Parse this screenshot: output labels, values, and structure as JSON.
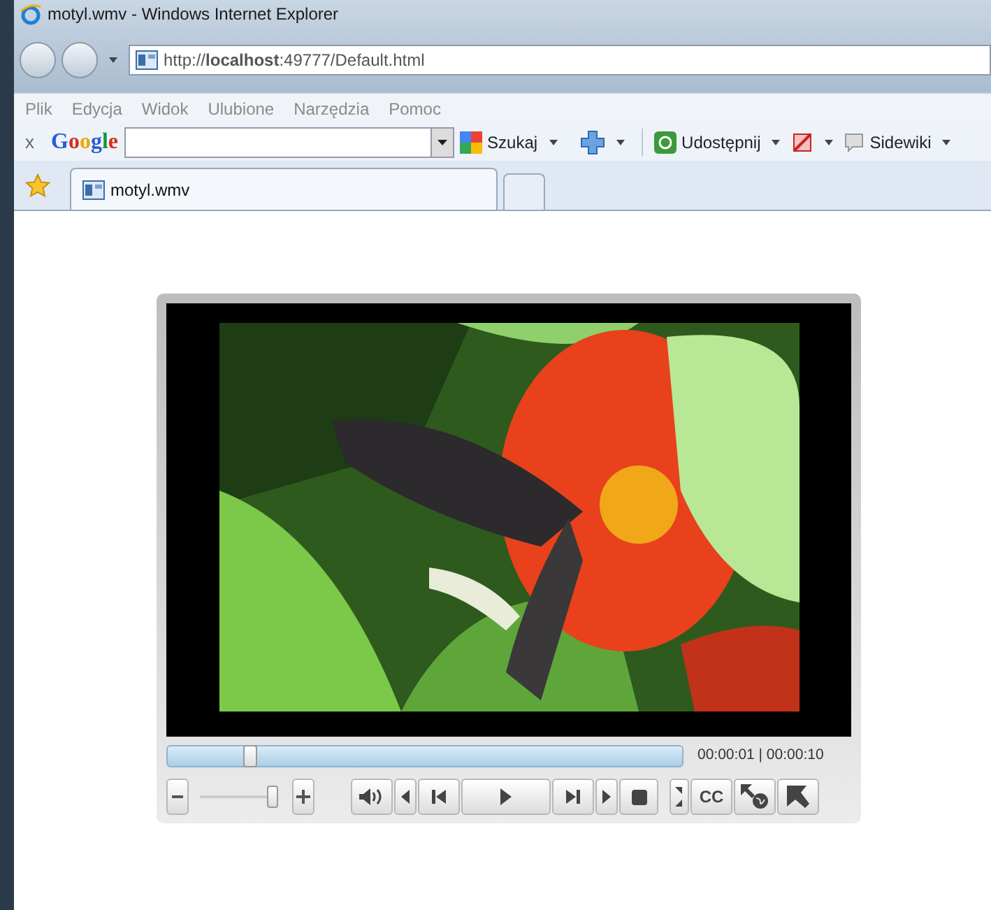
{
  "window": {
    "title": "motyl.wmv - Windows Internet Explorer"
  },
  "address": {
    "url": "http://**localhost**:49777/Default.html"
  },
  "menu": [
    "Plik",
    "Edycja",
    "Widok",
    "Ulubione",
    "Narzędzia",
    "Pomoc"
  ],
  "google_toolbar": {
    "close": "x",
    "logo": "Google",
    "search_button": "Szukaj",
    "share_button": "Udostępnij",
    "sidewiki_button": "Sidewiki"
  },
  "tabs": [
    {
      "label": "motyl.wmv",
      "selected": true
    }
  ],
  "player": {
    "seek": {
      "level": 0.16
    },
    "time": "00:00:01 | 00:00:10",
    "volume": {
      "level": 0.93
    },
    "captions_button": "CC"
  }
}
